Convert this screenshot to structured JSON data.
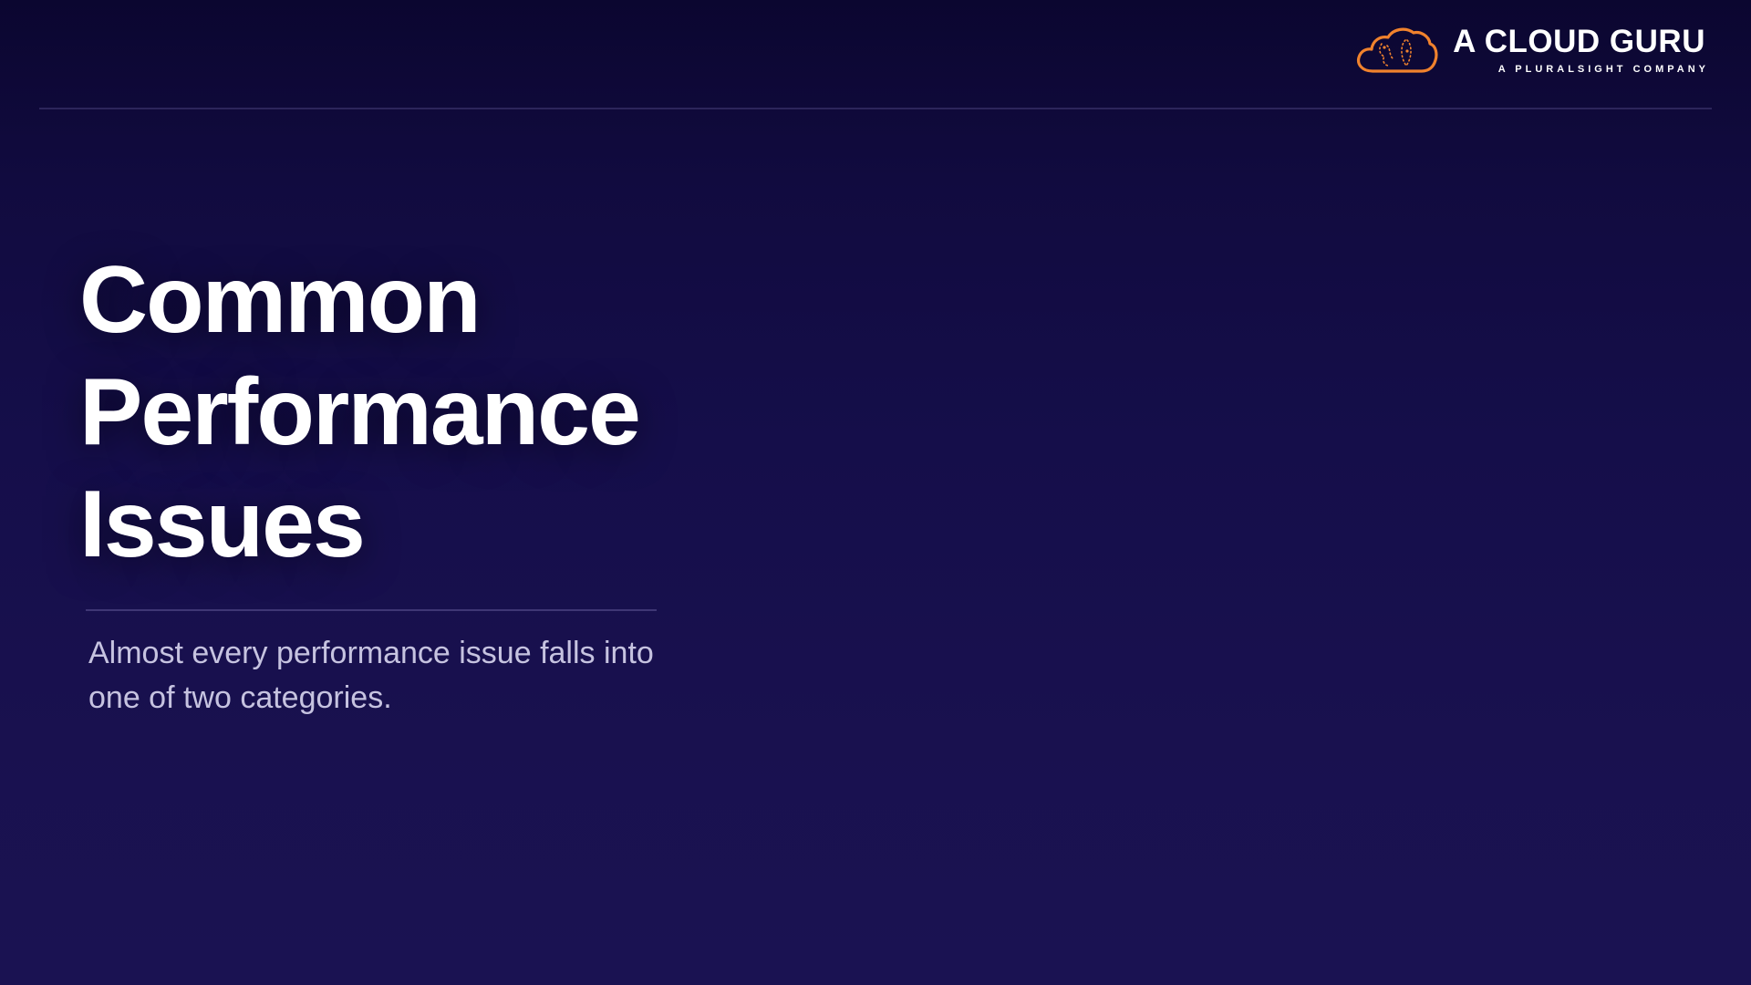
{
  "brand": {
    "name": "A CLOUD GURU",
    "tagline": "A PLURALSIGHT COMPANY",
    "icon": "cloud-guru-icon",
    "accent_color": "#f0822d"
  },
  "slide": {
    "title_lines": [
      "Common",
      "Performance",
      "Issues"
    ],
    "subtitle": "Almost every performance issue falls into one of two categories."
  },
  "colors": {
    "background_top": "#0b0630",
    "background_bottom": "#1a1252",
    "title": "#ffffff",
    "subtitle": "#c6c3e0"
  }
}
